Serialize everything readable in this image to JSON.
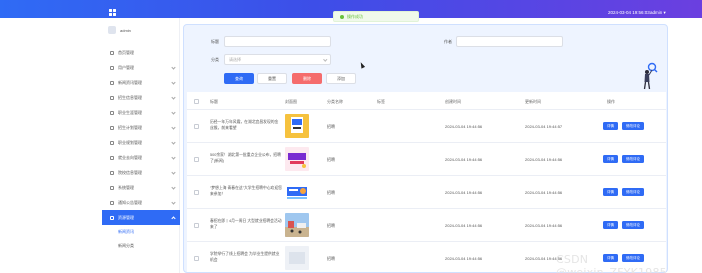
{
  "topbar": {
    "time": "2024-03-04 19:56:03",
    "user": "admin ▾"
  },
  "toast": {
    "text": "操作成功"
  },
  "sidebar": {
    "brand": "admin",
    "items": [
      {
        "label": "首页管理"
      },
      {
        "label": "用户管理"
      },
      {
        "label": "新闻资讯管理"
      },
      {
        "label": "招生信息管理"
      },
      {
        "label": "职业生涯管理"
      },
      {
        "label": "招生计划管理"
      },
      {
        "label": "职业规划管理"
      },
      {
        "label": "就业去向管理"
      },
      {
        "label": "院校信息管理"
      },
      {
        "label": "系统管理"
      },
      {
        "label": "通知公告管理"
      },
      {
        "label": "资源管理"
      }
    ],
    "sub_items": [
      {
        "label": "新闻资讯"
      },
      {
        "label": "新闻分类"
      }
    ]
  },
  "search": {
    "title_label": "标题",
    "category_label": "分类",
    "category_placeholder": "请选择",
    "author_label": "作者"
  },
  "buttons": {
    "search": "查询",
    "reset": "重置",
    "delete": "删除",
    "add": "添加"
  },
  "table": {
    "headers": [
      "标题",
      "封面图",
      "分类名称",
      "标签",
      "创建时间",
      "更新时间",
      "操作"
    ],
    "row_actions": {
      "detail": "详情",
      "edit": "修改评论"
    },
    "rows": [
      {
        "title": "历经一年万年风霜，在湖北宜昌发现的金丝猴，前来看望",
        "category": "招聘",
        "created": "2024-03-04 19:44:56",
        "updated": "2024-03-04 19:44:57"
      },
      {
        "title": "500余家！湖北第一批重点企业公布，招聘了(新闻)",
        "category": "招聘",
        "created": "2024-03-04 19:44:56",
        "updated": "2024-03-04 19:44:56"
      },
      {
        "title": "“梦想上海 青春在这”大学生招聘中心欢迎您来参加！",
        "category": "招聘",
        "created": "2024-03-04 19:44:56",
        "updated": "2024-03-04 19:44:56"
      },
      {
        "title": "春招在即丨4月一周日 大型就业招聘会活动来了",
        "category": "招聘",
        "created": "2024-03-04 19:44:56",
        "updated": "2024-03-04 19:44:56"
      },
      {
        "title": "学院举行了线上招聘会 为毕业生提供就业机会",
        "category": "招聘",
        "created": "2024-03-04 19:44:56",
        "updated": "2024-03-04 19:44:56"
      }
    ]
  },
  "watermark": "CSDN @weixin_ZFYK1985"
}
